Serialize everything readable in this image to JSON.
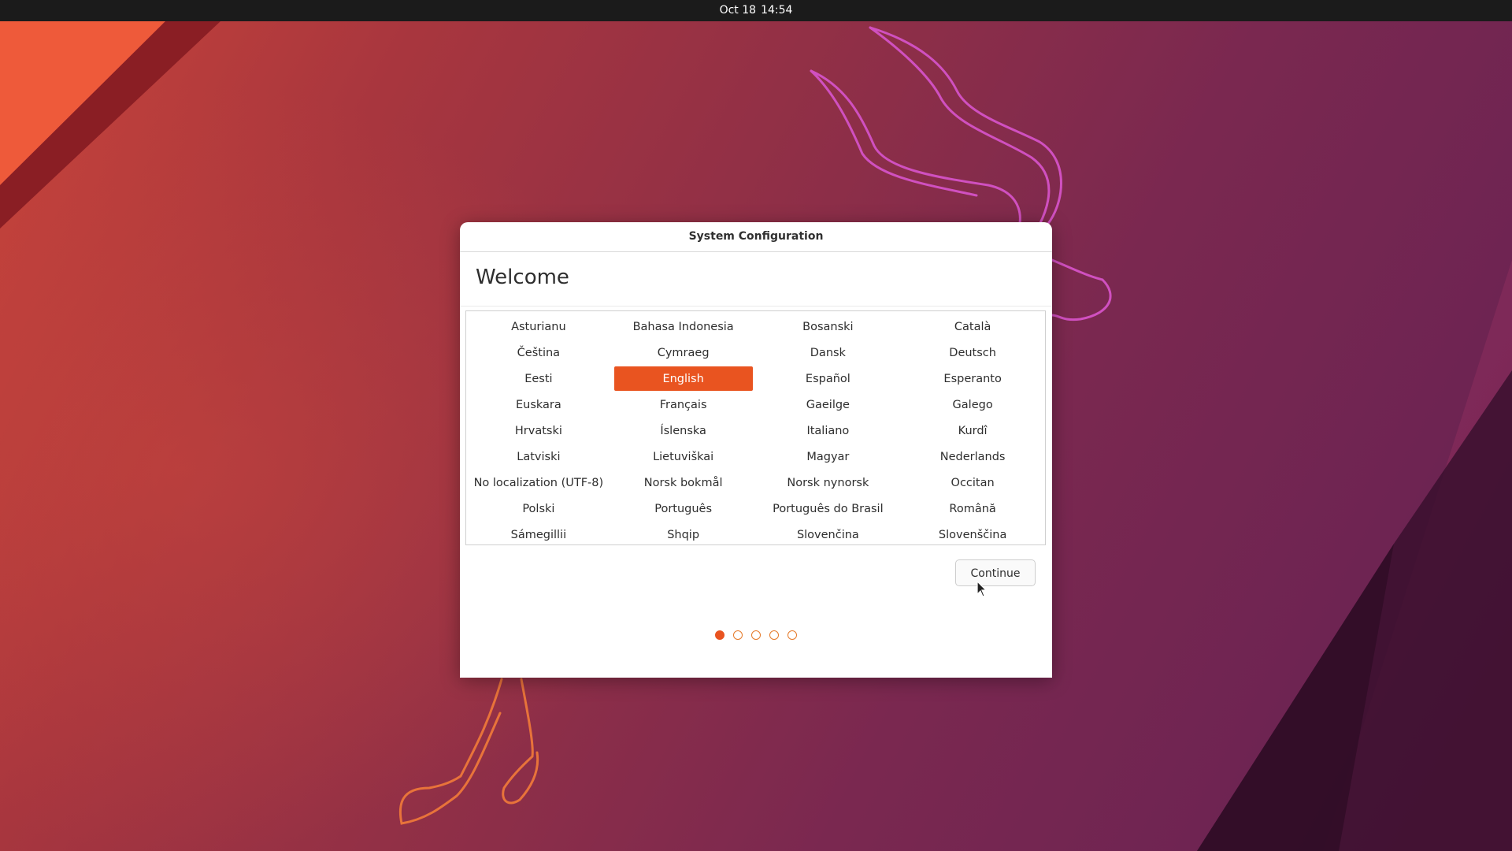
{
  "topbar": {
    "date": "Oct 18",
    "time": "14:54"
  },
  "dialog": {
    "title": "System Configuration",
    "heading": "Welcome",
    "continue_label": "Continue"
  },
  "languages": [
    "Asturianu",
    "Bahasa Indonesia",
    "Bosanski",
    "Català",
    "Čeština",
    "Cymraeg",
    "Dansk",
    "Deutsch",
    "Eesti",
    "English",
    "Español",
    "Esperanto",
    "Euskara",
    "Français",
    "Gaeilge",
    "Galego",
    "Hrvatski",
    "Íslenska",
    "Italiano",
    "Kurdî",
    "Latviski",
    "Lietuviškai",
    "Magyar",
    "Nederlands",
    "No localization (UTF-8)",
    "Norsk bokmål",
    "Norsk nynorsk",
    "Occitan",
    "Polski",
    "Português",
    "Português do Brasil",
    "Română",
    "Sámegillii",
    "Shqip",
    "Slovenčina",
    "Slovenščina"
  ],
  "selected_language": "English",
  "pager": {
    "total_steps": 5,
    "current_step": 1
  },
  "colors": {
    "accent": "#e95420",
    "topbar": "#1b1b1b",
    "wallpaper_warm": "#c8443a",
    "wallpaper_purple": "#6e2452"
  },
  "icons": {
    "pointer": "mouse-pointer-icon"
  }
}
